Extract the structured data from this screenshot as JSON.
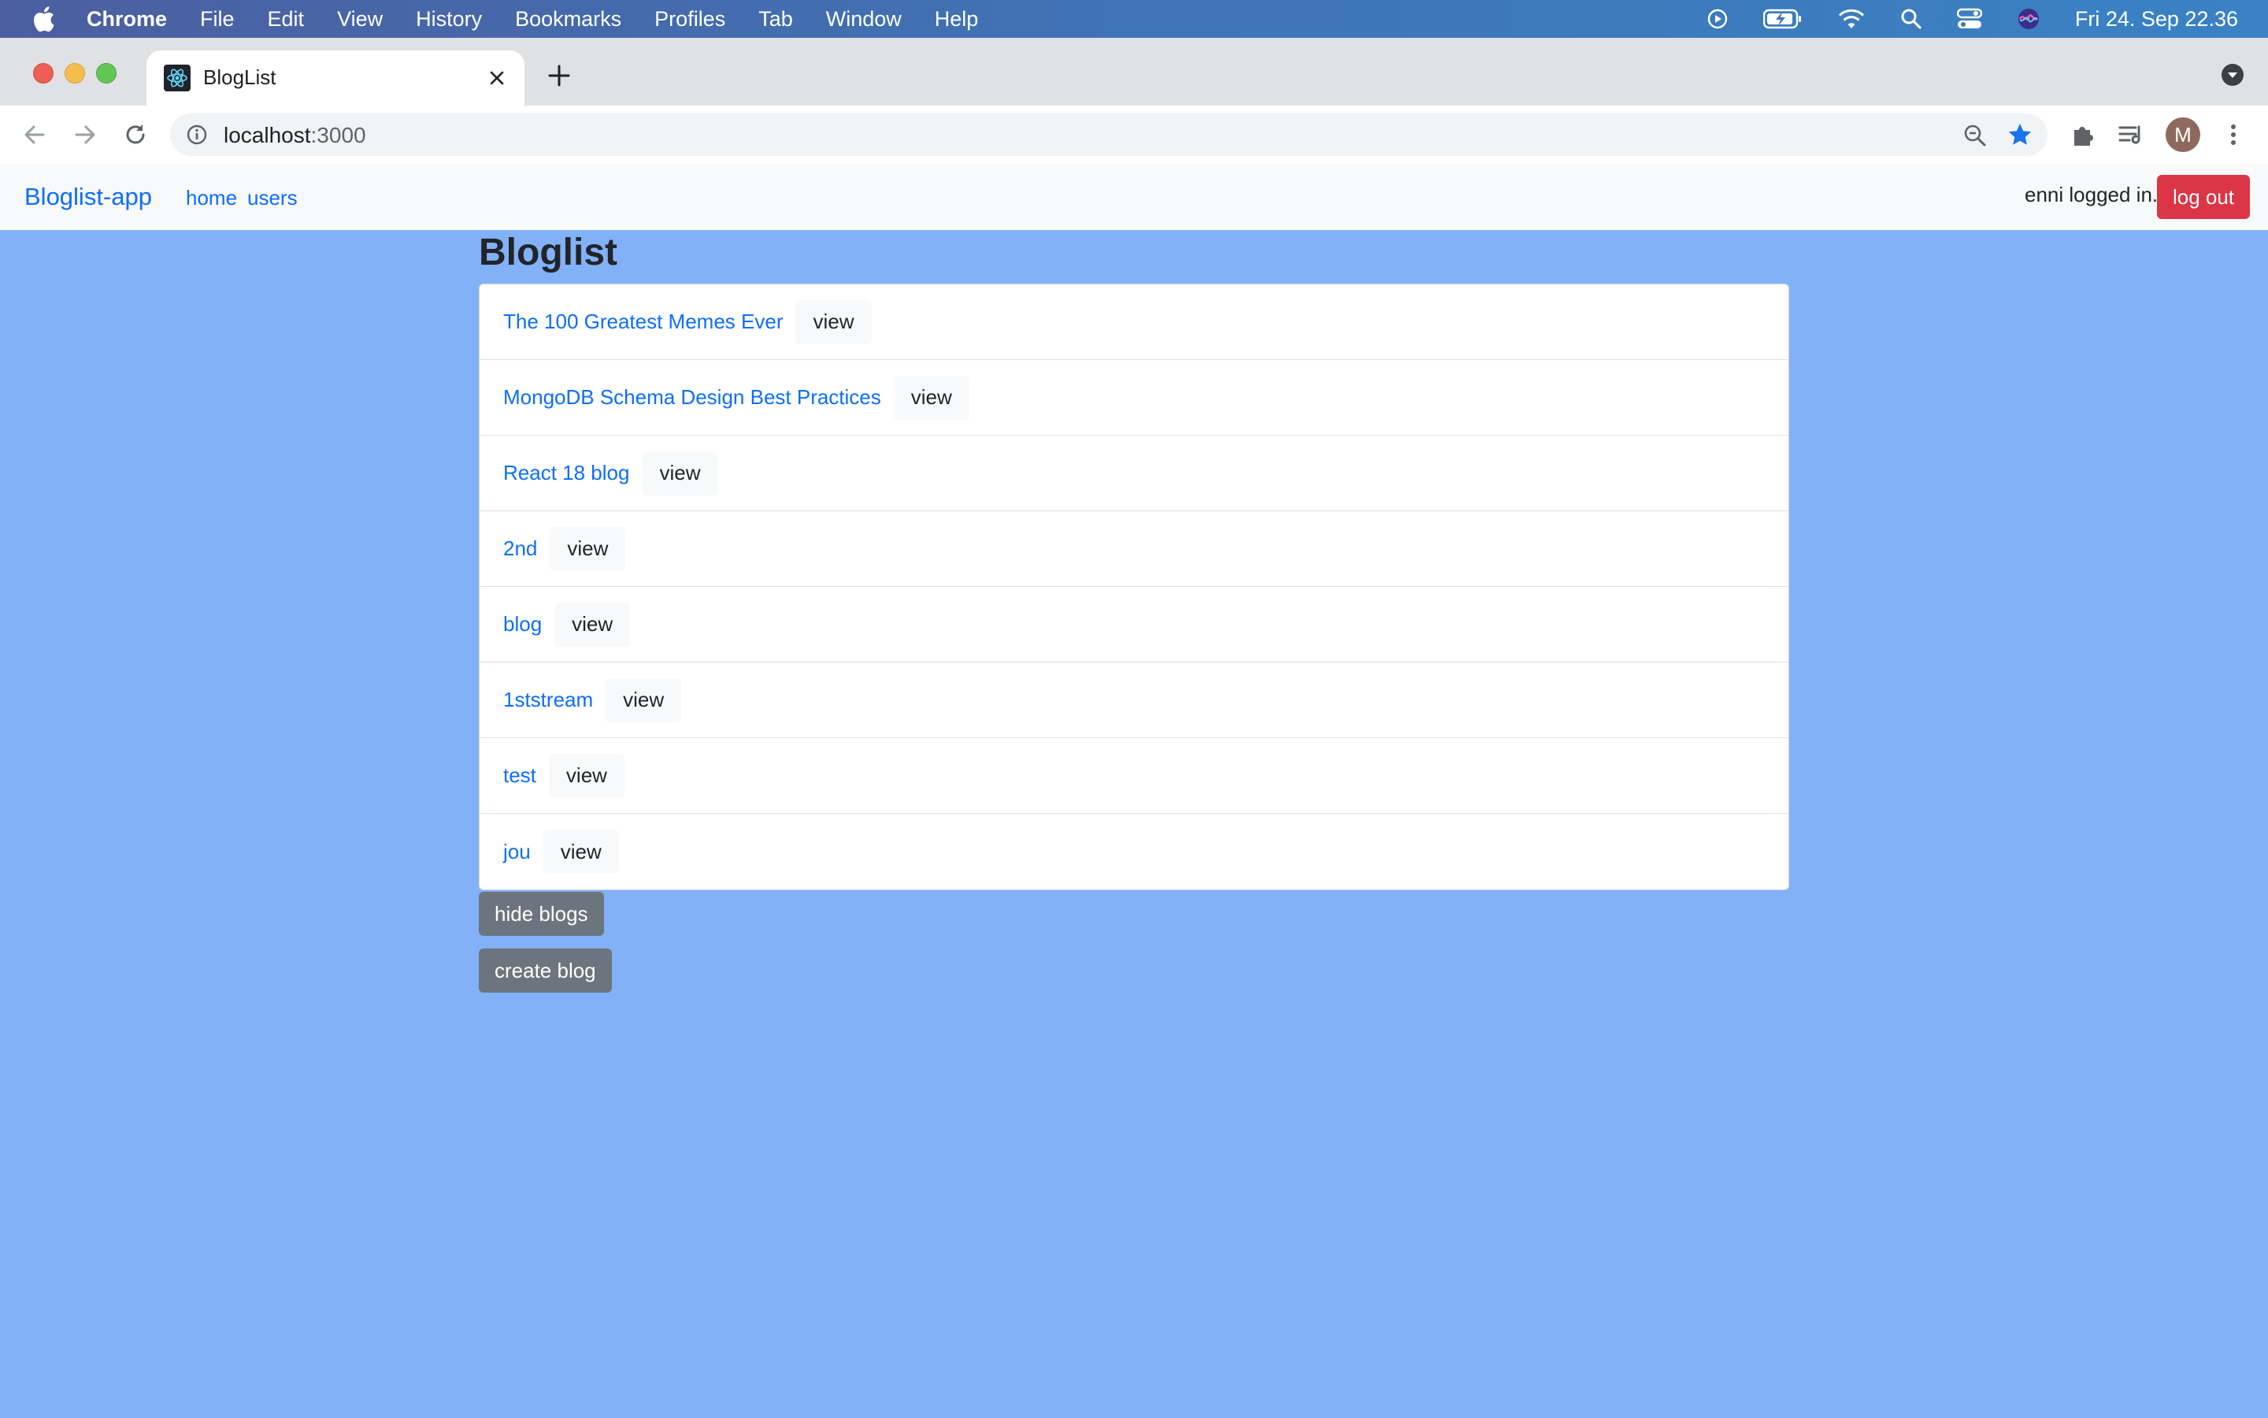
{
  "os_menubar": {
    "items": [
      "Chrome",
      "File",
      "Edit",
      "View",
      "History",
      "Bookmarks",
      "Profiles",
      "Tab",
      "Window",
      "Help"
    ],
    "clock": "Fri 24. Sep  22.36"
  },
  "browser": {
    "tab_title": "BlogList",
    "url_host": "localhost",
    "url_port": ":3000",
    "profile_initial": "M"
  },
  "navbar": {
    "brand": "Bloglist-app",
    "links": [
      "home",
      "users"
    ],
    "logged_in_text": "enni logged in.",
    "logout_label": "log out"
  },
  "main": {
    "heading": "Bloglist",
    "blogs": [
      {
        "title": "The 100 Greatest Memes Ever",
        "button": "view"
      },
      {
        "title": "MongoDB Schema Design Best Practices",
        "button": "view"
      },
      {
        "title": "React 18 blog",
        "button": "view"
      },
      {
        "title": "2nd",
        "button": "view"
      },
      {
        "title": "blog",
        "button": "view"
      },
      {
        "title": "1ststream",
        "button": "view"
      },
      {
        "title": "test",
        "button": "view"
      },
      {
        "title": "jou",
        "button": "view"
      }
    ],
    "hide_blogs_label": "hide blogs",
    "create_blog_label": "create blog"
  },
  "colors": {
    "page_background": "#82b1f8",
    "link": "#0d6efd",
    "danger": "#dc3545",
    "secondary": "#6c757d"
  }
}
